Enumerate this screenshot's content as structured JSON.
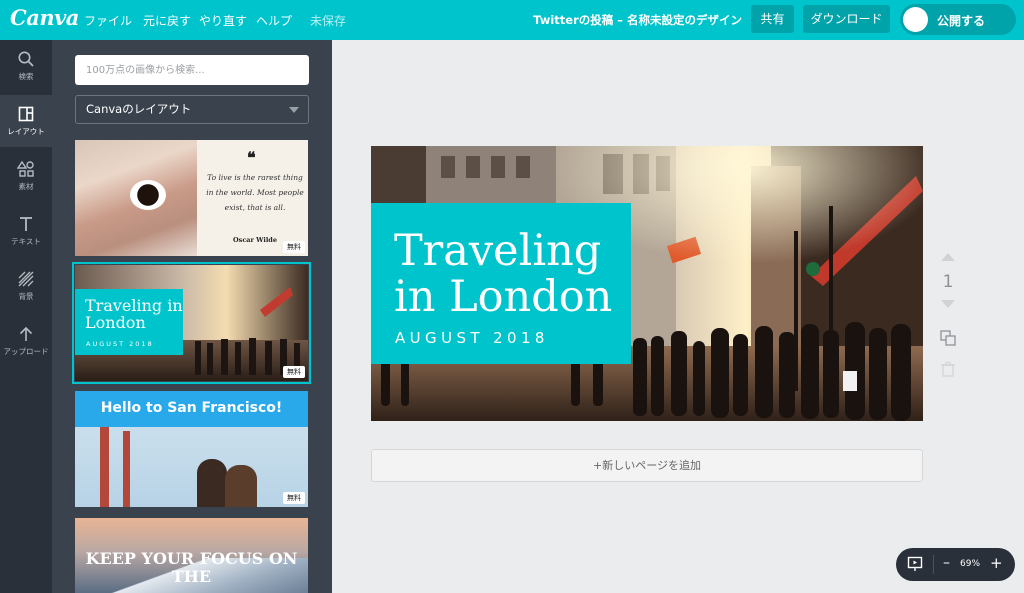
{
  "app": {
    "logo": "Canva",
    "menu": {
      "file": "ファイル",
      "undo": "元に戻す",
      "redo": "やり直す",
      "help": "ヘルプ",
      "unsaved": "未保存"
    },
    "doc_title": "Twitterの投稿 – 名称未設定のデザイン",
    "share_label": "共有",
    "download_label": "ダウンロード",
    "publish_label": "公開する"
  },
  "rail": {
    "search": "検索",
    "layouts": "レイアウト",
    "elements": "素材",
    "text": "テキスト",
    "background": "背景",
    "uploads": "アップロード"
  },
  "panel": {
    "search_placeholder": "100万点の画像から検索...",
    "layout_select": "Canvaのレイアウト",
    "free_badge": "無料",
    "templates": {
      "quote": {
        "mark": "❝",
        "text": "To live is the rarest thing in the world. Most people exist, that is all.",
        "author": "Oscar Wilde"
      },
      "london": {
        "title": "Traveling in London",
        "subtitle": "AUGUST 2018"
      },
      "sf": {
        "title": "Hello to San Francisco!"
      },
      "mountain": {
        "title": "KEEP YOUR FOCUS ON THE"
      }
    }
  },
  "canvas": {
    "title_line1": "Traveling",
    "title_line2": "in London",
    "subtitle": "AUGUST 2018",
    "add_page": "+新しいページを追加",
    "page_number": "1",
    "accent_color": "#00c4cc"
  },
  "zoom": {
    "value": "69%",
    "minus": "–",
    "plus": "+"
  }
}
